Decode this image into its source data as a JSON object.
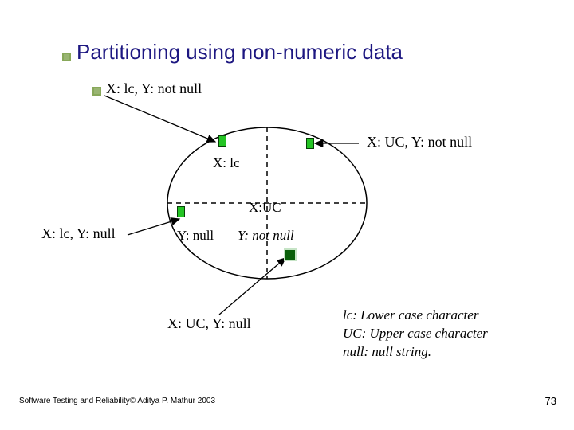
{
  "title": "Partitioning using non-numeric data",
  "labels": {
    "top_left": "X: lc, Y: not null",
    "top_right": "X: UC, Y: not null",
    "mid_left": "X: lc, Y: null",
    "inner_xlc": "X: lc",
    "inner_xuc": "X:UC",
    "inner_ynull": "Y: null",
    "inner_ynotnull": "Y: not null",
    "bottom_arrow": "X: UC, Y: null"
  },
  "legend": {
    "l1": "lc: Lower case character",
    "l2": "UC: Upper case  character",
    "l3": "null: null string."
  },
  "footer": "Software Testing and Reliability© Aditya P. Mathur 2003",
  "page_number": "73"
}
